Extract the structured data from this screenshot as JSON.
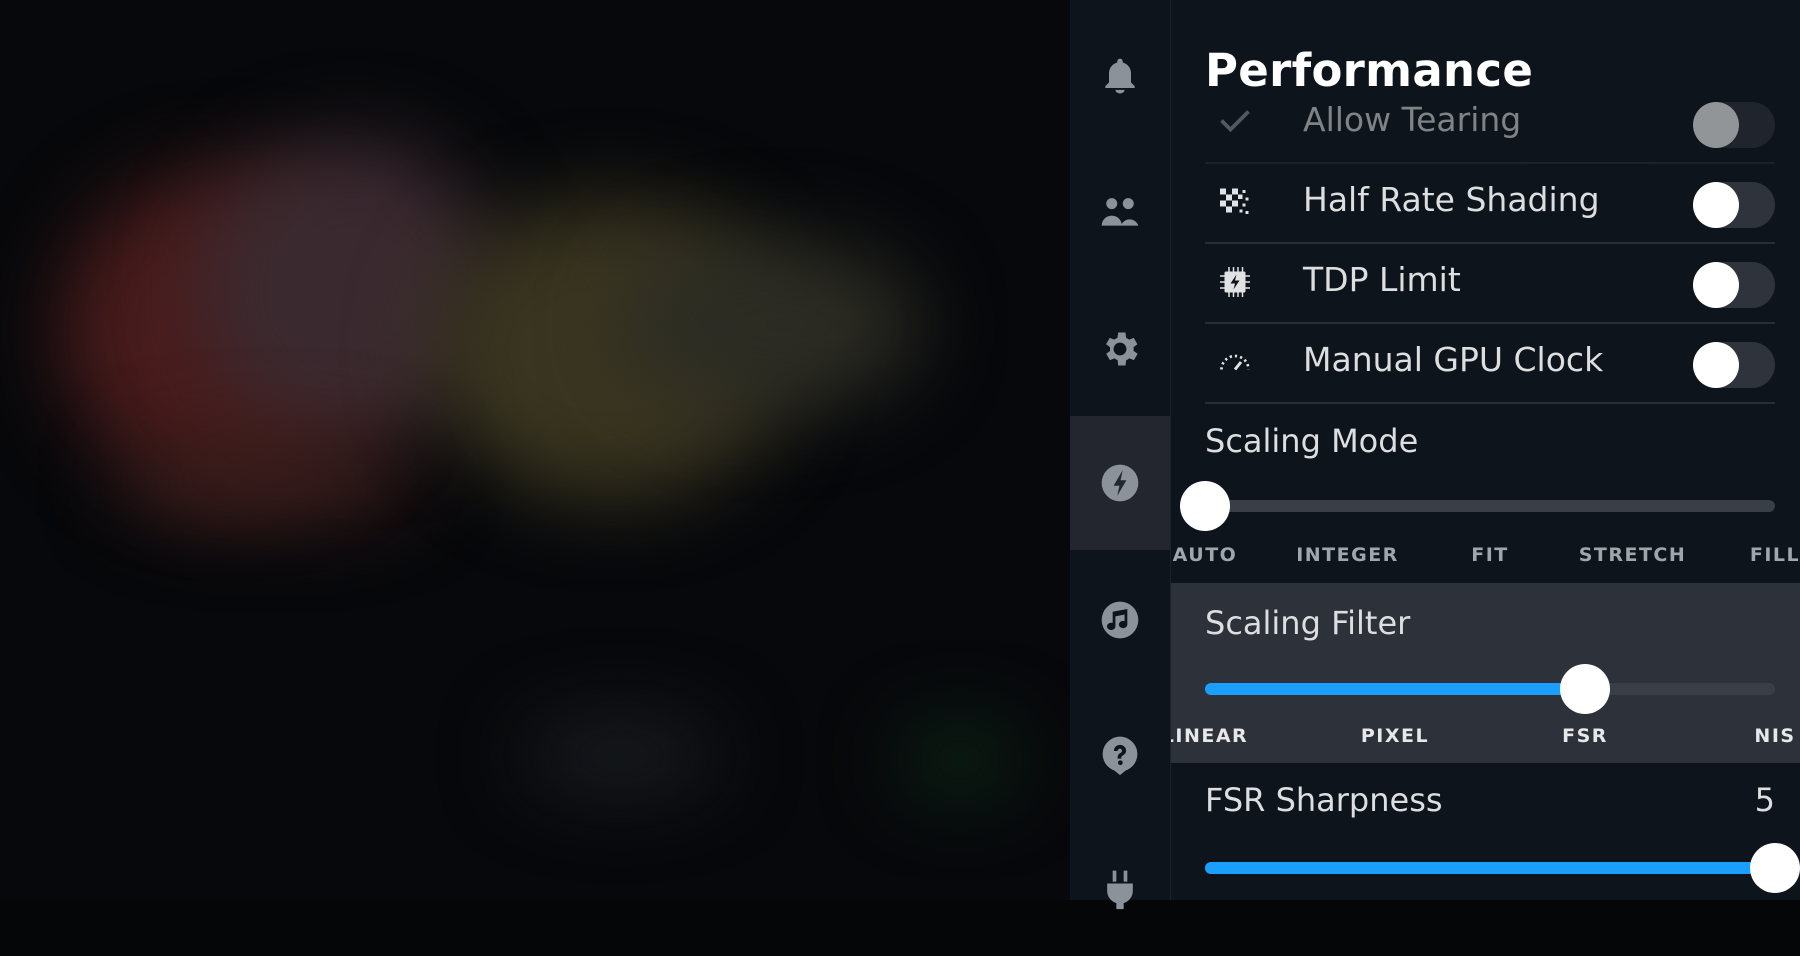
{
  "background": {
    "description": "blurred game library artwork"
  },
  "sidebar": {
    "items": [
      {
        "name": "notifications",
        "icon": "bell-icon",
        "active": false
      },
      {
        "name": "friends",
        "icon": "friends-icon",
        "active": false
      },
      {
        "name": "settings",
        "icon": "gear-icon",
        "active": false
      },
      {
        "name": "performance",
        "icon": "lightning-icon",
        "active": true
      },
      {
        "name": "music",
        "icon": "music-note-icon",
        "active": false
      },
      {
        "name": "help",
        "icon": "help-icon",
        "active": false
      },
      {
        "name": "power",
        "icon": "plug-icon",
        "active": false
      }
    ]
  },
  "panel": {
    "title": "Performance",
    "toggles": [
      {
        "label": "Allow Tearing",
        "icon": "checkmark-icon",
        "on": false
      },
      {
        "label": "Half Rate Shading",
        "icon": "checkerboard-icon",
        "on": false
      },
      {
        "label": "TDP Limit",
        "icon": "chip-icon",
        "on": false
      },
      {
        "label": "Manual GPU Clock",
        "icon": "gauge-icon",
        "on": false
      }
    ],
    "scaling_mode": {
      "label": "Scaling Mode",
      "options": [
        "AUTO",
        "INTEGER",
        "FIT",
        "STRETCH",
        "FILL"
      ],
      "selected_index": 0
    },
    "scaling_filter": {
      "label": "Scaling Filter",
      "options": [
        "LINEAR",
        "PIXEL",
        "FSR",
        "NIS"
      ],
      "selected_index": 2
    },
    "fsr_sharpness": {
      "label": "FSR Sharpness",
      "value": "5",
      "min": 0,
      "max": 5
    }
  },
  "colors": {
    "accent": "#1a9fff",
    "panel_bg": "#0e141b",
    "highlight_bg": "#2d3139"
  }
}
